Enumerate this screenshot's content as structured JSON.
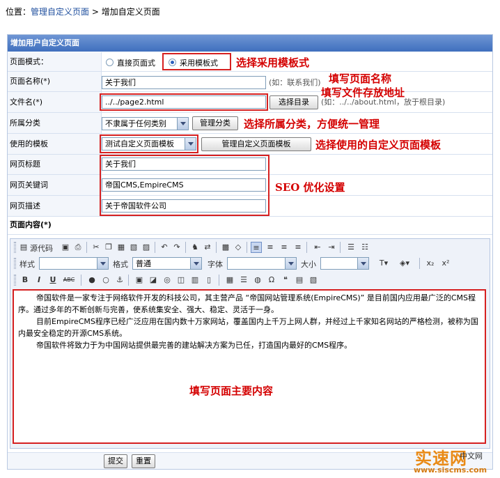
{
  "breadcrumb": {
    "prefix": "位置：",
    "link": "管理自定义页面",
    "sep": " > ",
    "current": "增加自定义页面"
  },
  "form": {
    "title": "增加用户自定义页面",
    "mode": {
      "label": "页面模式：",
      "opt1": "直接页面式",
      "opt2": "采用模板式"
    },
    "name": {
      "label": "页面名称(*)",
      "value": "关于我们",
      "hint": "(如：联系我们)"
    },
    "filename": {
      "label": "文件名(*)",
      "value": "../../page2.html",
      "button": "选择目录",
      "hint": "(如：../../about.html，放于根目录)"
    },
    "category": {
      "label": "所属分类",
      "value": "不隶属于任何类别",
      "button": "管理分类"
    },
    "template": {
      "label": "使用的模板",
      "value": "测试自定义页面模板",
      "button": "管理自定义页面模板"
    },
    "seo_title": {
      "label": "网页标题",
      "value": "关于我们"
    },
    "seo_keywords": {
      "label": "网页关键词",
      "value": "帝国CMS,EmpireCMS"
    },
    "seo_desc": {
      "label": "网页描述",
      "value": "关于帝国软件公司"
    },
    "content_label": "页面内容(*)",
    "submit": "提交",
    "reset": "重置"
  },
  "editor": {
    "source_label": "源代码",
    "style_label": "样式",
    "format_label": "格式",
    "format_value": "普通",
    "font_label": "字体",
    "size_label": "大小",
    "bold": "B",
    "italic": "I",
    "underline": "U",
    "strike": "ABC",
    "sub": "x₂",
    "sup": "x²",
    "paragraphs": [
      "帝国软件是一家专注于网络软件开发的科技公司，其主营产品 “帝国网站管理系统(EmpireCMS)” 是目前国内应用最广泛的CMS程序。通过多年的不断创新与完善，使系统集安全、强大、稳定、灵活于一身。",
      "目前EmpireCMS程序已经广泛应用在国内数十万家网站，覆盖国内上千万上网人群，并经过上千家知名网站的严格检测，被称为国内最安全稳定的开源CMS系统。",
      "帝国软件将致力于为中国网站提供最完善的建站解决方案为已任，打造国内最好的CMS程序。"
    ]
  },
  "annotations": {
    "mode": "选择采用模板式",
    "name": "填写页面名称",
    "file": "填写文件存放地址",
    "category": "选择所属分类，方便统一管理",
    "template": "选择使用的自定义页面模板",
    "seo": "SEO 优化设置",
    "content": "填写页面主要内容"
  },
  "watermark": {
    "brand": "实速网",
    "suffix": "中文网",
    "url": "www.siscms.com"
  }
}
